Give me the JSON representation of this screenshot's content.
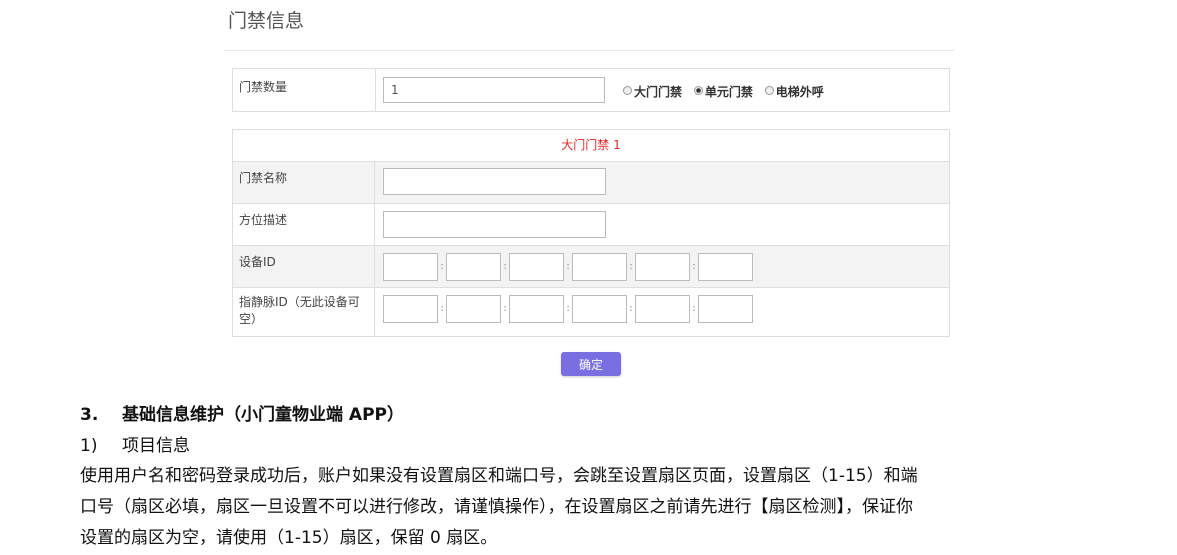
{
  "panel": {
    "title": "门禁信息",
    "count_label": "门禁数量",
    "count_value": "1",
    "door_types": [
      {
        "label": "大门门禁",
        "checked": false
      },
      {
        "label": "单元门禁",
        "checked": true
      },
      {
        "label": "电梯外呼",
        "checked": false
      }
    ],
    "entry_header": "大门门禁 1",
    "fields": [
      {
        "label": "门禁名称"
      },
      {
        "label": "方位描述"
      },
      {
        "label": "设备ID"
      },
      {
        "label": "指静脉ID（无此设备可空）"
      }
    ],
    "segment_separator": ":",
    "confirm_label": "确定"
  },
  "doc": {
    "section_number": "3.",
    "section_title": "基础信息维护（小门童物业端 APP）",
    "sub_number": "1)",
    "sub_title": "项目信息",
    "paragraph_lines": [
      "使用用户名和密码登录成功后，账户如果没有设置扇区和端口号，会跳至设置扇区页面，设置扇区（1-15）和端",
      "口号（扇区必填，扇区一旦设置不可以进行修改，请谨慎操作），在设置扇区之前请先进行【扇区检测】，保证你",
      "设置的扇区为空，请使用（1-15）扇区，保留 0 扇区。"
    ]
  },
  "colors": {
    "accent": "#7a6fe0",
    "header_red": "#e02a2a"
  }
}
